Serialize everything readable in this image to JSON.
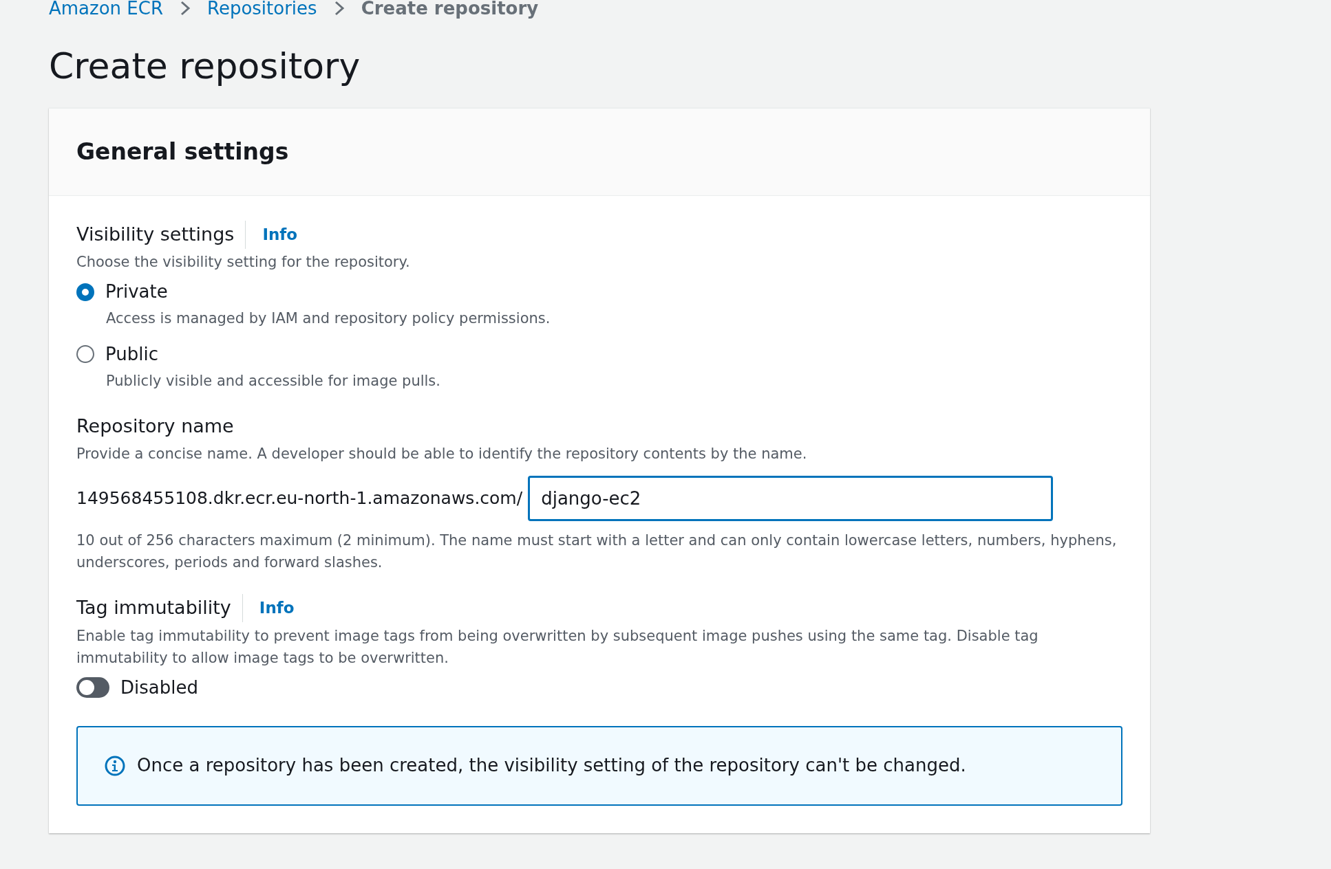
{
  "breadcrumbs": [
    {
      "label": "Amazon ECR",
      "kind": "link"
    },
    {
      "label": "Repositories",
      "kind": "link"
    },
    {
      "label": "Create repository",
      "kind": "current"
    }
  ],
  "page_title": "Create repository",
  "panel": {
    "title": "General settings",
    "visibility": {
      "label": "Visibility settings",
      "info": "Info",
      "description": "Choose the visibility setting for the repository.",
      "options": [
        {
          "label": "Private",
          "description": "Access is managed by IAM and repository policy permissions.",
          "selected": true
        },
        {
          "label": "Public",
          "description": "Publicly visible and accessible for image pulls.",
          "selected": false
        }
      ]
    },
    "repository_name": {
      "label": "Repository name",
      "description": "Provide a concise name. A developer should be able to identify the repository contents by the name.",
      "prefix": "149568455108.dkr.ecr.eu-north-1.amazonaws.com/",
      "value": "django-ec2",
      "hint": "10 out of 256 characters maximum (2 minimum). The name must start with a letter and can only contain lowercase letters, numbers, hyphens, underscores, periods and forward slashes."
    },
    "tag_immutability": {
      "label": "Tag immutability",
      "info": "Info",
      "description": "Enable tag immutability to prevent image tags from being overwritten by subsequent image pushes using the same tag. Disable tag immutability to allow image tags to be overwritten.",
      "on": false,
      "state_label": "Disabled"
    },
    "alert": "Once a repository has been created, the visibility setting of the repository can't be changed."
  }
}
